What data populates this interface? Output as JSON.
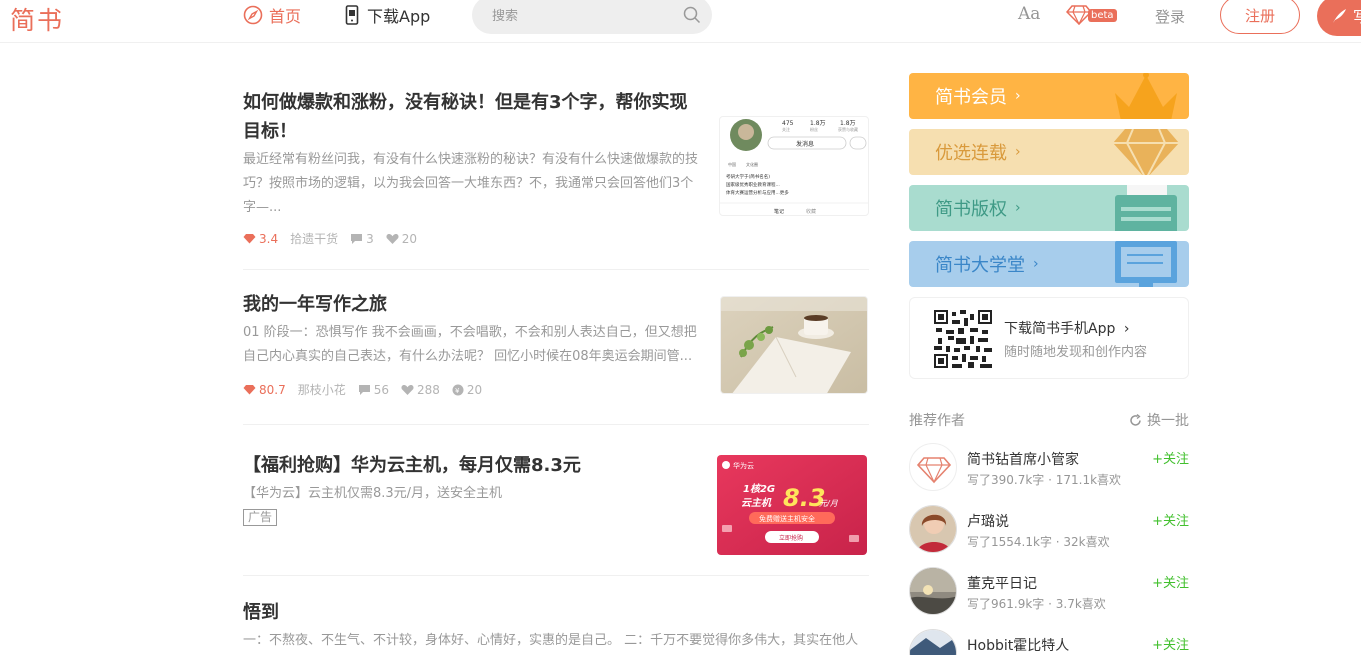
{
  "header": {
    "logo": "简书",
    "nav_home": "首页",
    "nav_app": "下载App",
    "search_placeholder": "搜索",
    "font_toggle": "Aa",
    "beta": "beta",
    "login": "登录",
    "signup": "注册",
    "write": "写文章"
  },
  "articles": [
    {
      "title": "如何做爆款和涨粉，没有秘诀！但是有3个字，帮你实现目标！",
      "abstract": "最近经常有粉丝问我，有没有什么快速涨粉的秘诀？有没有什么快速做爆款的技巧？按照市场的逻辑，以为我会回答一大堆东西？不，我通常只会回答他们3个字—...",
      "score": "3.4",
      "author": "拾遗干货",
      "comments": "3",
      "likes": "20",
      "thumb": {
        "stat1": "475",
        "stat1_label": "关注",
        "stat2": "1.8万",
        "stat2_label": "粉丝",
        "stat3": "1.8万",
        "stat3_label": "获赞与收藏",
        "msg_button": "发消息",
        "tag1": "中国",
        "tag2": "文化圈",
        "line1": "考研大学于(简书名名)",
        "line2": "国家级优秀职业教育课程...",
        "line3": "体育大赛运营分析与应用...更多",
        "tab1": "笔记",
        "tab2": "收藏"
      }
    },
    {
      "title": "我的一年写作之旅",
      "abstract": "01 阶段一：恐惧写作 我不会画画，不会唱歌，不会和别人表达自己，但又想把自己内心真实的自己表达，有什么办法呢？ 回忆小时候在08年奥运会期间管...",
      "score": "80.7",
      "author": "那枝小花",
      "comments": "56",
      "likes": "288",
      "rewards": "20"
    },
    {
      "title": "【福利抢购】华为云主机，每月仅需8.3元",
      "abstract": "【华为云】云主机仅需8.3元/月，送安全主机",
      "ad_tag": "广告",
      "ad": {
        "brand": "华为云",
        "spec": "1核2G",
        "product": "云主机",
        "price": "8.3",
        "unit": "元/月",
        "ribbon": "免费赠送主机安全",
        "cta": "立即抢购"
      }
    },
    {
      "title": "悟到",
      "abstract": "一：不熬夜、不生气、不计较，身体好、心情好，实惠的是自己。 二：千万不要觉得你多伟大，其实在他人"
    }
  ],
  "sidebar": {
    "banners": [
      {
        "label": "简书会员",
        "color": "#ffb444"
      },
      {
        "label": "优选连载",
        "color": "#f6dfb0"
      },
      {
        "label": "简书版权",
        "color": "#a9dccf"
      },
      {
        "label": "简书大学堂",
        "color": "#a7cdec"
      }
    ],
    "app_title": "下载简书手机App",
    "app_sub": "随时随地发现和创作内容",
    "rec_title": "推荐作者",
    "rec_refresh": "换一批",
    "follow_label": "+关注",
    "authors": [
      {
        "name": "简书钻首席小管家",
        "info": "写了390.7k字 · 171.1k喜欢"
      },
      {
        "name": "卢璐说",
        "info": "写了1554.1k字 · 32k喜欢"
      },
      {
        "name": "董克平日记",
        "info": "写了961.9k字 · 3.7k喜欢"
      },
      {
        "name": "Hobbit霍比特人",
        "info": ""
      }
    ]
  },
  "colors": {
    "accent": "#ea6f5a",
    "follow": "#42c02e"
  }
}
